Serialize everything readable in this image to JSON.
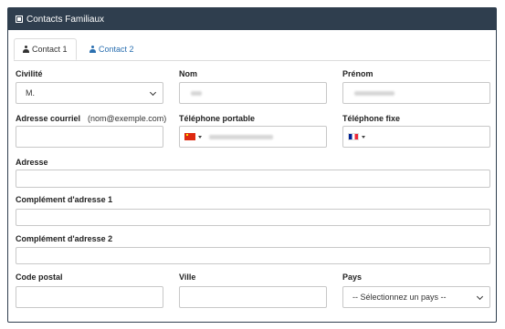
{
  "panel": {
    "title": "Contacts Familiaux"
  },
  "tabs": [
    {
      "label": "Contact 1",
      "active": true
    },
    {
      "label": "Contact 2",
      "active": false
    }
  ],
  "form": {
    "civilite": {
      "label": "Civilité",
      "value": "M."
    },
    "nom": {
      "label": "Nom"
    },
    "prenom": {
      "label": "Prénom"
    },
    "email": {
      "label": "Adresse courriel",
      "hint": "(nom@exemple.com)"
    },
    "tel_portable": {
      "label": "Téléphone portable",
      "flag": "china-flag-icon"
    },
    "tel_fixe": {
      "label": "Téléphone fixe",
      "flag": "france-flag-icon"
    },
    "adresse": {
      "label": "Adresse"
    },
    "complement1": {
      "label": "Complément d'adresse 1"
    },
    "complement2": {
      "label": "Complément d'adresse 2"
    },
    "code_postal": {
      "label": "Code postal"
    },
    "ville": {
      "label": "Ville"
    },
    "pays": {
      "label": "Pays",
      "placeholder": "-- Sélectionnez un pays --"
    }
  },
  "colors": {
    "header_bg": "#2f3e4e",
    "tab_link": "#2a6fb0"
  }
}
